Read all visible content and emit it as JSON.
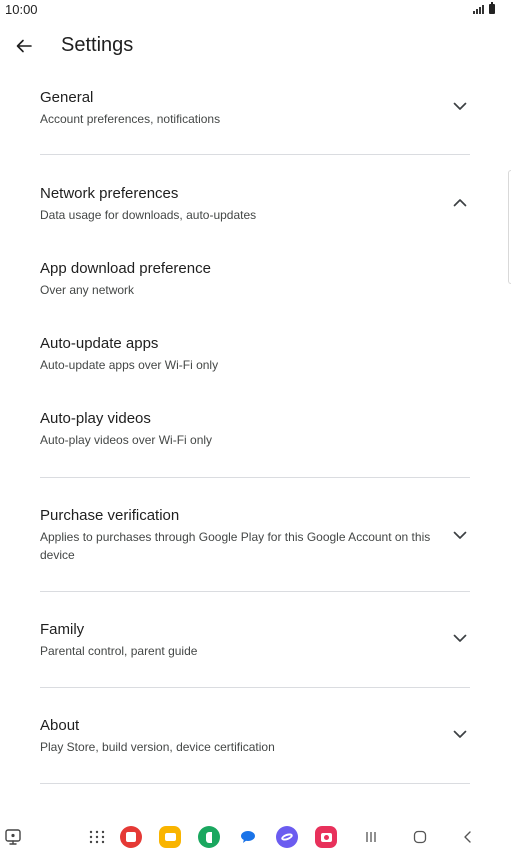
{
  "status_bar": {
    "time": "10:00"
  },
  "header": {
    "title": "Settings"
  },
  "sections": [
    {
      "title": "General",
      "subtitle": "Account preferences, notifications",
      "expanded": false
    },
    {
      "title": "Network preferences",
      "subtitle": "Data usage for downloads, auto-updates",
      "expanded": true,
      "items": [
        {
          "title": "App download preference",
          "subtitle": "Over any network"
        },
        {
          "title": "Auto-update apps",
          "subtitle": "Auto-update apps over Wi-Fi only"
        },
        {
          "title": "Auto-play videos",
          "subtitle": "Auto-play videos over Wi-Fi only"
        }
      ]
    },
    {
      "title": "Purchase verification",
      "subtitle": "Applies to purchases through Google Play for this Google Account on this device",
      "expanded": false
    },
    {
      "title": "Family",
      "subtitle": "Parental control, parent guide",
      "expanded": false
    },
    {
      "title": "About",
      "subtitle": "Play Store, build version, device certification",
      "expanded": false
    }
  ],
  "nav": {
    "apps": [
      {
        "name": "notes-app-icon",
        "color": "#e53935"
      },
      {
        "name": "files-app-icon",
        "color": "#f9b400"
      },
      {
        "name": "phone-app-icon",
        "color": "#1aa75f"
      },
      {
        "name": "messages-app-icon",
        "color": "#1a73e8"
      },
      {
        "name": "internet-app-icon",
        "color": "#6b5cf0"
      },
      {
        "name": "camera-app-icon",
        "color": "#e8315b"
      }
    ]
  },
  "colors": {
    "text": "#1f1f1f",
    "subtext": "#444746",
    "divider": "#dadce0"
  }
}
